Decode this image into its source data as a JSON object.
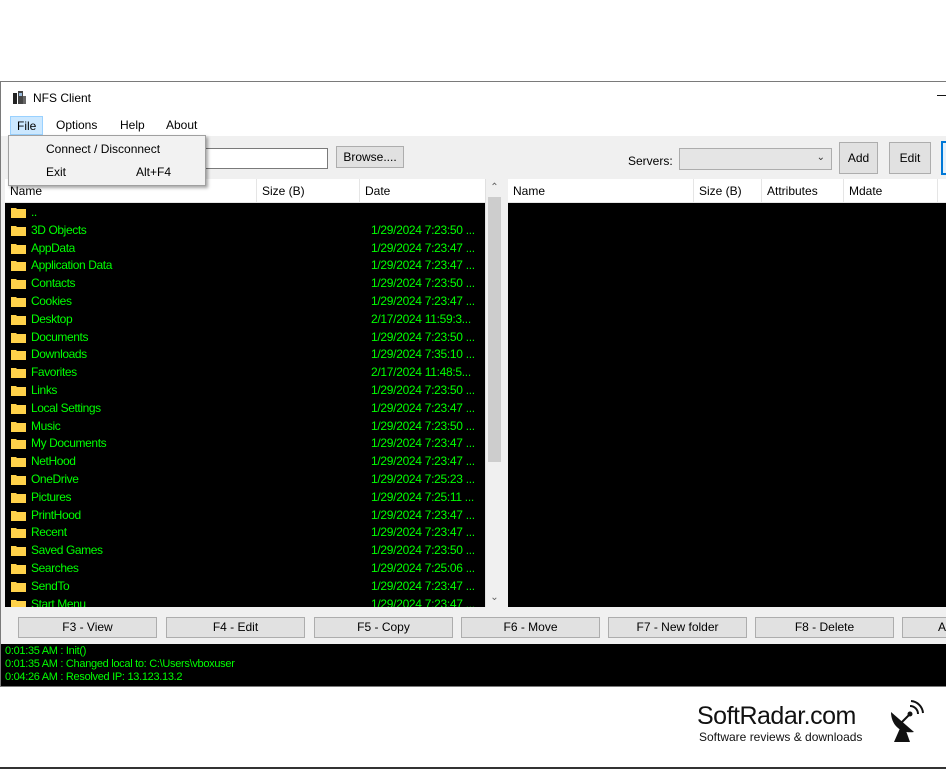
{
  "window": {
    "title": "NFS Client",
    "minimize_glyph": "—"
  },
  "menu": {
    "items": [
      "File",
      "Options",
      "Help",
      "About"
    ],
    "file_dropdown": [
      {
        "label": "Connect / Disconnect",
        "shortcut": ""
      },
      {
        "label": "Exit",
        "shortcut": "Alt+F4"
      }
    ]
  },
  "toolbar": {
    "path_value": "",
    "browse_label": "Browse....",
    "servers_label": "Servers:",
    "servers_selected": "",
    "add_label": "Add",
    "edit_label": "Edit"
  },
  "local_pane": {
    "columns": [
      "Name",
      "Size (B)",
      "Date"
    ],
    "rows": [
      {
        "name": "..",
        "date": ""
      },
      {
        "name": "3D Objects",
        "date": "1/29/2024 7:23:50 ..."
      },
      {
        "name": "AppData",
        "date": "1/29/2024 7:23:47 ..."
      },
      {
        "name": "Application Data",
        "date": "1/29/2024 7:23:47 ..."
      },
      {
        "name": "Contacts",
        "date": "1/29/2024 7:23:50 ..."
      },
      {
        "name": "Cookies",
        "date": "1/29/2024 7:23:47 ..."
      },
      {
        "name": "Desktop",
        "date": "2/17/2024 11:59:3..."
      },
      {
        "name": "Documents",
        "date": "1/29/2024 7:23:50 ..."
      },
      {
        "name": "Downloads",
        "date": "1/29/2024 7:35:10 ..."
      },
      {
        "name": "Favorites",
        "date": "2/17/2024 11:48:5..."
      },
      {
        "name": "Links",
        "date": "1/29/2024 7:23:50 ..."
      },
      {
        "name": "Local Settings",
        "date": "1/29/2024 7:23:47 ..."
      },
      {
        "name": "Music",
        "date": "1/29/2024 7:23:50 ..."
      },
      {
        "name": "My Documents",
        "date": "1/29/2024 7:23:47 ..."
      },
      {
        "name": "NetHood",
        "date": "1/29/2024 7:23:47 ..."
      },
      {
        "name": "OneDrive",
        "date": "1/29/2024 7:25:23 ..."
      },
      {
        "name": "Pictures",
        "date": "1/29/2024 7:25:11 ..."
      },
      {
        "name": "PrintHood",
        "date": "1/29/2024 7:23:47 ..."
      },
      {
        "name": "Recent",
        "date": "1/29/2024 7:23:47 ..."
      },
      {
        "name": "Saved Games",
        "date": "1/29/2024 7:23:50 ..."
      },
      {
        "name": "Searches",
        "date": "1/29/2024 7:25:06 ..."
      },
      {
        "name": "SendTo",
        "date": "1/29/2024 7:23:47 ..."
      },
      {
        "name": "Start Menu",
        "date": "1/29/2024 7:23:47 ..."
      }
    ]
  },
  "remote_pane": {
    "columns": [
      "Name",
      "Size (B)",
      "Attributes",
      "Mdate"
    ]
  },
  "function_keys": [
    "F3 - View",
    "F4 - Edit",
    "F5 - Copy",
    "F6 - Move",
    "F7 - New folder",
    "F8 - Delete",
    "A"
  ],
  "log": [
    "0:01:35 AM : Init()",
    "0:01:35 AM : Changed local to: C:\\Users\\vboxuser",
    "0:04:26 AM : Resolved IP: 13.123.13.2"
  ],
  "branding": {
    "title": "SoftRadar.com",
    "subtitle": "Software reviews & downloads"
  },
  "colors": {
    "list_text": "#00ff00",
    "list_bg": "#000000",
    "folder": "#ffd24a"
  }
}
